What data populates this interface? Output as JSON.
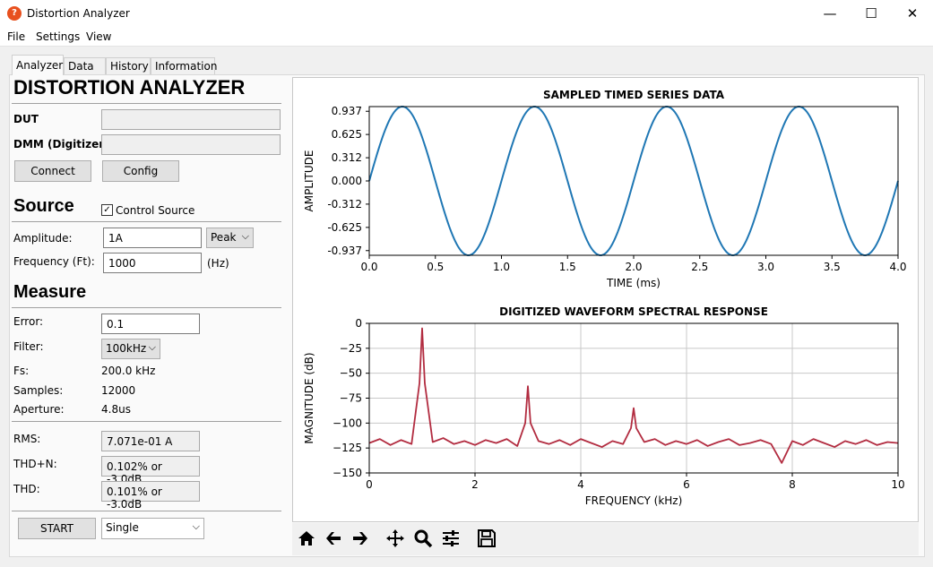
{
  "window": {
    "title": "Distortion Analyzer",
    "icon_glyph": "?"
  },
  "controls": {
    "minimize": "—",
    "maximize": "☐",
    "close": "✕"
  },
  "menu": [
    "File",
    "Settings",
    "View"
  ],
  "tabs": [
    "Analyzer",
    "Data",
    "History",
    "Information"
  ],
  "active_tab": "Analyzer",
  "heading": "DISTORTION ANALYZER",
  "instruments": {
    "dut_label": "DUT",
    "dut_value": "",
    "dmm_label": "DMM (Digitizer)",
    "dmm_value": "",
    "connect": "Connect",
    "config": "Config"
  },
  "source": {
    "heading": "Source",
    "control_label": "Control Source",
    "control_checked": true,
    "amplitude_label": "Amplitude:",
    "amplitude_value": "1A",
    "amplitude_mode": "Peak",
    "frequency_label": "Frequency (Ft):",
    "frequency_value": "1000",
    "frequency_unit": "(Hz)"
  },
  "measure": {
    "heading": "Measure",
    "error_label": "Error:",
    "error_value": "0.1",
    "filter_label": "Filter:",
    "filter_value": "100kHz",
    "fs_label": "Fs:",
    "fs_value": "200.0 kHz",
    "samples_label": "Samples:",
    "samples_value": "12000",
    "aperture_label": "Aperture:",
    "aperture_value": "4.8us",
    "rms_label": "RMS:",
    "rms_value": "7.071e-01 A",
    "thdn_label": "THD+N:",
    "thdn_value": "0.102% or -3.0dB",
    "thd_label": "THD:",
    "thd_value": "0.101% or -3.0dB"
  },
  "run": {
    "start": "START",
    "mode": "Single"
  },
  "toolbar_icons": [
    "home-icon",
    "back-arrow-icon",
    "forward-arrow-icon",
    "pan-icon",
    "zoom-icon",
    "subplots-icon",
    "save-icon"
  ],
  "colors": {
    "time_series": "#1f77b4",
    "spectrum": "#b22c40",
    "accent": "#0078d7"
  },
  "chart_data": [
    {
      "type": "line",
      "title": "SAMPLED TIMED SERIES DATA",
      "xlabel": "TIME (ms)",
      "ylabel": "AMPLITUDE",
      "xlim": [
        0.0,
        4.0
      ],
      "ylim": [
        -1.0,
        1.0
      ],
      "xticks": [
        "0.0",
        "0.5",
        "1.0",
        "1.5",
        "2.0",
        "2.5",
        "3.0",
        "3.5",
        "4.0"
      ],
      "yticks": [
        "0.937",
        "0.625",
        "0.312",
        "0.000",
        "-0.312",
        "-0.625",
        "-0.937"
      ],
      "grid": false,
      "series": [
        {
          "x": [
            0.0,
            0.25,
            0.5,
            0.75,
            1.0,
            1.25,
            1.5,
            1.75,
            2.0,
            2.25,
            2.5,
            2.75,
            3.0,
            3.25,
            3.5,
            3.75,
            4.0
          ],
          "y": [
            0.0,
            1.0,
            0.0,
            -1.0,
            0.0,
            1.0,
            0.0,
            -1.0,
            0.0,
            1.0,
            0.0,
            -1.0,
            0.0,
            1.0,
            0.0,
            -1.0,
            0.0
          ]
        }
      ]
    },
    {
      "type": "line",
      "title": "DIGITIZED WAVEFORM SPECTRAL RESPONSE",
      "xlabel": "FREQUENCY (kHz)",
      "ylabel": "MAGNITUDE (dB)",
      "xlim": [
        0,
        10
      ],
      "ylim": [
        -150,
        0
      ],
      "xticks": [
        "0",
        "2",
        "4",
        "6",
        "8",
        "10"
      ],
      "yticks": [
        "0",
        "−25",
        "−50",
        "−75",
        "−100",
        "−125",
        "−150"
      ],
      "grid": true,
      "series": [
        {
          "x": [
            0.0,
            0.2,
            0.4,
            0.6,
            0.8,
            0.95,
            1.0,
            1.05,
            1.2,
            1.4,
            1.6,
            1.8,
            2.0,
            2.2,
            2.4,
            2.6,
            2.8,
            2.95,
            3.0,
            3.05,
            3.2,
            3.4,
            3.6,
            3.8,
            4.0,
            4.2,
            4.4,
            4.6,
            4.8,
            4.95,
            5.0,
            5.05,
            5.2,
            5.4,
            5.6,
            5.8,
            6.0,
            6.2,
            6.4,
            6.6,
            6.8,
            7.0,
            7.2,
            7.4,
            7.6,
            7.8,
            8.0,
            8.2,
            8.4,
            8.6,
            8.8,
            9.0,
            9.2,
            9.4,
            9.6,
            9.8,
            10.0
          ],
          "y": [
            -120,
            -116,
            -122,
            -117,
            -121,
            -60,
            -5,
            -60,
            -119,
            -115,
            -121,
            -118,
            -122,
            -117,
            -120,
            -116,
            -123,
            -100,
            -63,
            -100,
            -118,
            -121,
            -117,
            -122,
            -116,
            -120,
            -124,
            -118,
            -121,
            -105,
            -85,
            -105,
            -119,
            -116,
            -122,
            -118,
            -121,
            -117,
            -123,
            -119,
            -116,
            -122,
            -120,
            -117,
            -121,
            -140,
            -118,
            -122,
            -116,
            -120,
            -124,
            -118,
            -121,
            -117,
            -122,
            -119,
            -120
          ]
        }
      ]
    }
  ]
}
